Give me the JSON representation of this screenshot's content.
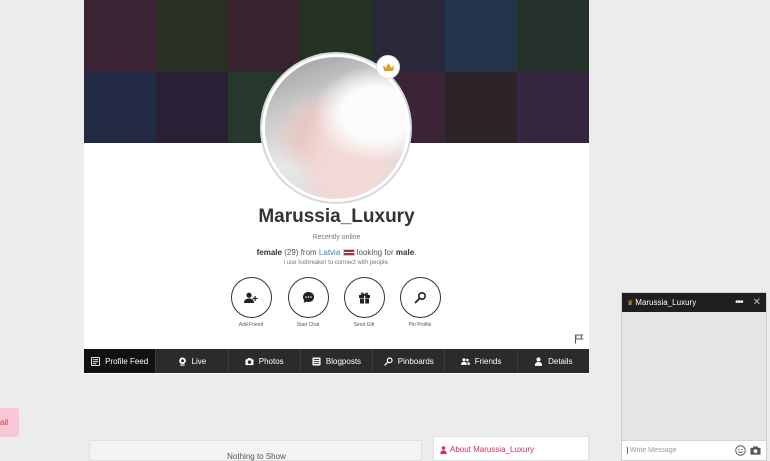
{
  "side_tab": {
    "label": "ail"
  },
  "cover": {
    "tiles": [
      "#3a2433",
      "#2a2f24",
      "#38232e",
      "#243226",
      "#2a2838",
      "#22334a",
      "#24302a",
      "#232a44",
      "#2a2036",
      "#26382c",
      "#2b2238",
      "#3a2436",
      "#2c2426",
      "#362640"
    ]
  },
  "profile": {
    "username": "Marussia_Luxury",
    "status": "Recently online",
    "gender": "female",
    "age_text": "(29)",
    "from_text": "from",
    "country": "Latvia",
    "looking_text": "looking for",
    "looking_for": "male",
    "icebreaker_text": "I use Icebreaker to connect with people.",
    "premium_icon": "crown-icon"
  },
  "actions": [
    {
      "label": "Add Friend",
      "icon": "add-friend-icon"
    },
    {
      "label": "Start Chat",
      "icon": "chat-bubble-icon"
    },
    {
      "label": "Send Gift",
      "icon": "gift-icon"
    },
    {
      "label": "Pin Profile",
      "icon": "pin-icon"
    }
  ],
  "tabs": [
    {
      "label": "Profile Feed",
      "icon": "feed-icon",
      "active": true
    },
    {
      "label": "Live",
      "icon": "webcam-icon",
      "active": false
    },
    {
      "label": "Photos",
      "icon": "camera-icon",
      "active": false
    },
    {
      "label": "Blogposts",
      "icon": "blog-icon",
      "active": false
    },
    {
      "label": "Pinboards",
      "icon": "pin-icon",
      "active": false
    },
    {
      "label": "Friends",
      "icon": "friends-icon",
      "active": false
    },
    {
      "label": "Details",
      "icon": "user-icon",
      "active": false
    }
  ],
  "feed": {
    "empty_text": "Nothing to Show"
  },
  "about": {
    "title": "About Marussia_Luxury"
  },
  "chat": {
    "title": "Marussia_Luxury",
    "menu": "•••",
    "close": "✕",
    "input_placeholder": "Write Message"
  },
  "colors": {
    "accent": "#d0304f",
    "link": "#3b7fd3",
    "tabbar": "#2b2b2b",
    "crown": "#e0a020"
  }
}
